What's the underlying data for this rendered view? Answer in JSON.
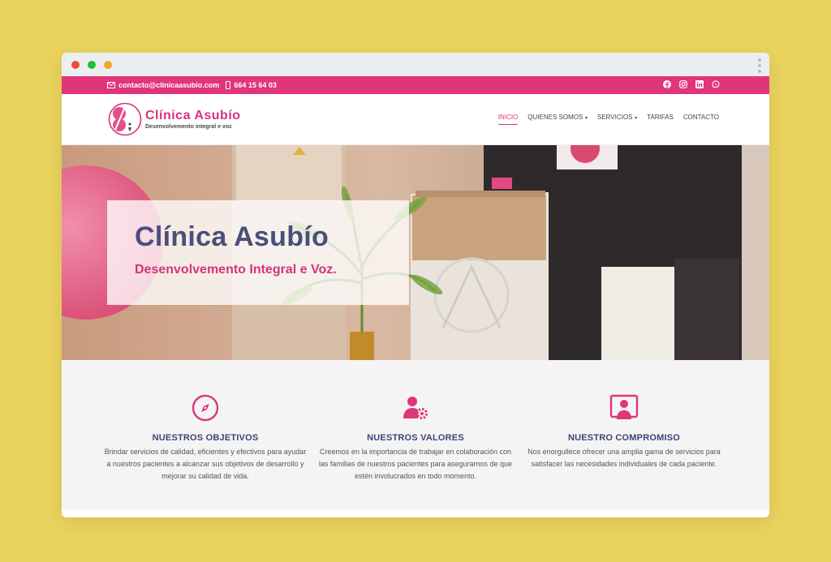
{
  "topbar": {
    "email": "contacto@clinicaasubio.com",
    "phone": "664 15 64 03",
    "socials": [
      "facebook-icon",
      "instagram-icon",
      "linkedin-icon",
      "whatsapp-icon"
    ]
  },
  "logo": {
    "title": "Clínica Asubío",
    "subtitle": "Desenvolvemento integral e voz"
  },
  "nav": {
    "items": [
      {
        "label": "INICIO",
        "active": true,
        "dropdown": false
      },
      {
        "label": "QUIENES SOMOS",
        "active": false,
        "dropdown": true
      },
      {
        "label": "SERVICIOS",
        "active": false,
        "dropdown": true
      },
      {
        "label": "TARIFAS",
        "active": false,
        "dropdown": false
      },
      {
        "label": "CONTACTO",
        "active": false,
        "dropdown": false
      }
    ]
  },
  "hero": {
    "title": "Clínica Asubío",
    "subtitle": "Desenvolvemento Integral e Voz."
  },
  "features": [
    {
      "icon": "compass-icon",
      "title": "NUESTROS OBJETIVOS",
      "text": "Brindar servicios de calidad, eficientes y efectivos para ayudar a nuestros pacientes a alcanzar sus objetivos de desarrollo y mejorar su calidad de vida."
    },
    {
      "icon": "user-gear-icon",
      "title": "NUESTROS VALORES",
      "text": "Creemos en la importancia de trabajar en colaboración con las familias de nuestros pacientes para asegurarnos de que estén involucrados en todo momento."
    },
    {
      "icon": "user-screen-icon",
      "title": "NUESTRO COMPROMISO",
      "text": "Nos enorgullece ofrecer una amplia gama de servicios para satisfacer las necesidades individuales de cada paciente."
    }
  ],
  "colors": {
    "accent": "#e0357b",
    "heading": "#4a4f7a",
    "background": "#ead35f"
  }
}
